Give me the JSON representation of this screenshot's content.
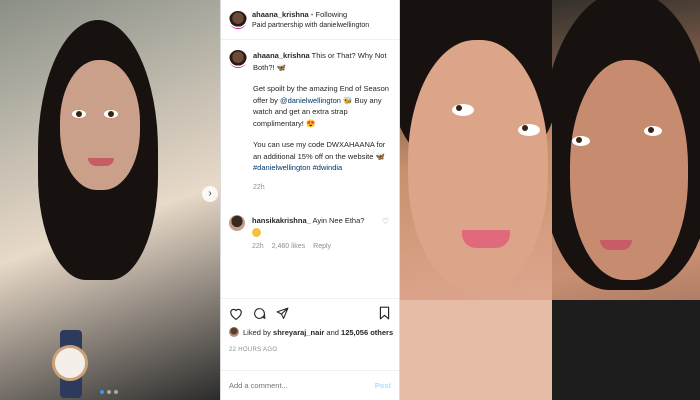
{
  "header": {
    "username": "ahaana_krishna",
    "separator": "•",
    "follow_label": "Following",
    "subtitle": "Paid partnership with danielwellington"
  },
  "caption": {
    "username": "ahaana_krishna",
    "line1": "This or That? Why Not Both?!",
    "para2_before": "Get spoilt by the amazing End of Season offer by ",
    "para2_link": "@danielwellington",
    "para2_after": " Buy any watch and get an extra strap complimentary!",
    "para3": "You can use my code DWXAHAANA for an additional 15% off on the website",
    "hashtags": "#danielwellington #dwindia",
    "time": "22h"
  },
  "comment": {
    "username": "hansikakrishna_",
    "text": "Ayin Nee Etha?",
    "time": "22h",
    "likes": "2,460 likes",
    "reply_label": "Reply"
  },
  "likes": {
    "prefix": "Liked by",
    "user": "shreyaraj_nair",
    "and": "and",
    "count": "125,056 others"
  },
  "timestamp": "22 HOURS AGO",
  "add_comment": {
    "placeholder": "Add a comment...",
    "post_label": "Post"
  },
  "carousel": {
    "slide_count": 3,
    "active_slide": 1
  },
  "colors": {
    "link": "#00376b",
    "muted": "#8e8e8e",
    "post_button": "#b2dffc",
    "active_dot": "#3897f0"
  }
}
